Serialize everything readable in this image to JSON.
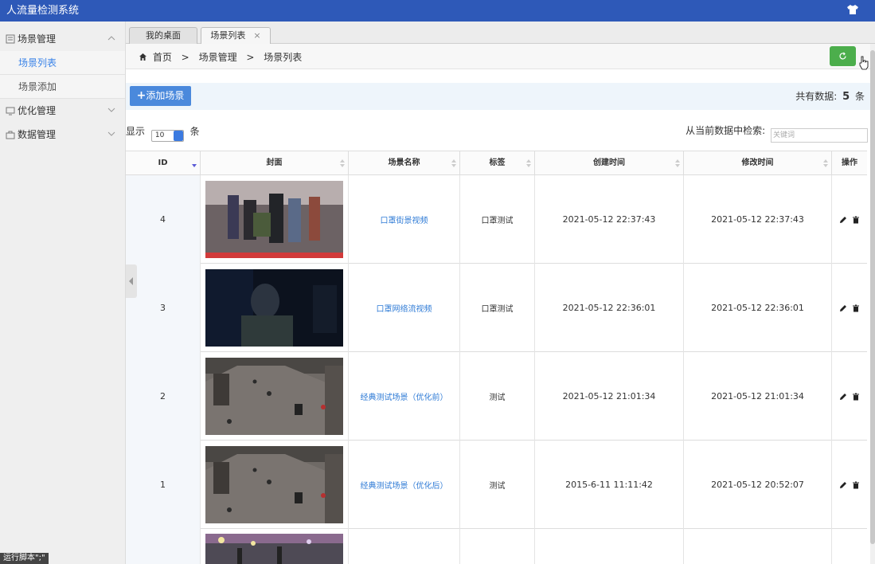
{
  "app": {
    "title": "人流量检测系统"
  },
  "sidebar": {
    "groups": [
      {
        "label": "场景管理",
        "items": [
          {
            "label": "场景列表"
          },
          {
            "label": "场景添加"
          }
        ]
      },
      {
        "label": "优化管理"
      },
      {
        "label": "数据管理"
      }
    ],
    "run_badge": "运行脚本\";\""
  },
  "tabs": [
    {
      "label": "我的桌面"
    },
    {
      "label": "场景列表",
      "close": "×"
    }
  ],
  "breadcrumb": {
    "home": "首页",
    "sep": ">",
    "level1": "场景管理",
    "level2": "场景列表"
  },
  "toolbar": {
    "add_label": "添加场景",
    "total_prefix": "共有数据:",
    "total_count": "5",
    "total_suffix": "条"
  },
  "listing": {
    "show_prefix": "显示",
    "page_size": "10",
    "show_suffix": "条",
    "search_label": "从当前数据中检索:",
    "search_placeholder": "关键词"
  },
  "table": {
    "headers": [
      "ID",
      "封面",
      "场景名称",
      "标签",
      "创建时间",
      "修改时间",
      "操作"
    ],
    "rows": [
      {
        "id": "4",
        "name": "口罩街景视频",
        "tag": "口罩测试",
        "created": "2021-05-12 22:37:43",
        "modified": "2021-05-12 22:37:43",
        "cover": "street-crowd"
      },
      {
        "id": "3",
        "name": "口罩网络流视频",
        "tag": "口罩测试",
        "created": "2021-05-12 22:36:01",
        "modified": "2021-05-12 22:36:01",
        "cover": "dark-webcam"
      },
      {
        "id": "2",
        "name": "经典测试场景（优化前）",
        "tag": "测试",
        "created": "2021-05-12 21:01:34",
        "modified": "2021-05-12 21:01:34",
        "cover": "mall-overhead"
      },
      {
        "id": "1",
        "name": "经典测试场景（优化后）",
        "tag": "测试",
        "created": "2015-6-11 11:11:42",
        "modified": "2021-05-12 20:52:07",
        "cover": "mall-overhead"
      }
    ]
  },
  "icons": {
    "edit": "pencil-icon",
    "delete": "trash-icon",
    "refresh": "refresh-icon",
    "home": "home-icon"
  },
  "colors": {
    "header": "#2e59b8",
    "accent": "#4a89dc",
    "refresh": "#4cae4c",
    "link": "#2f7bd6"
  }
}
